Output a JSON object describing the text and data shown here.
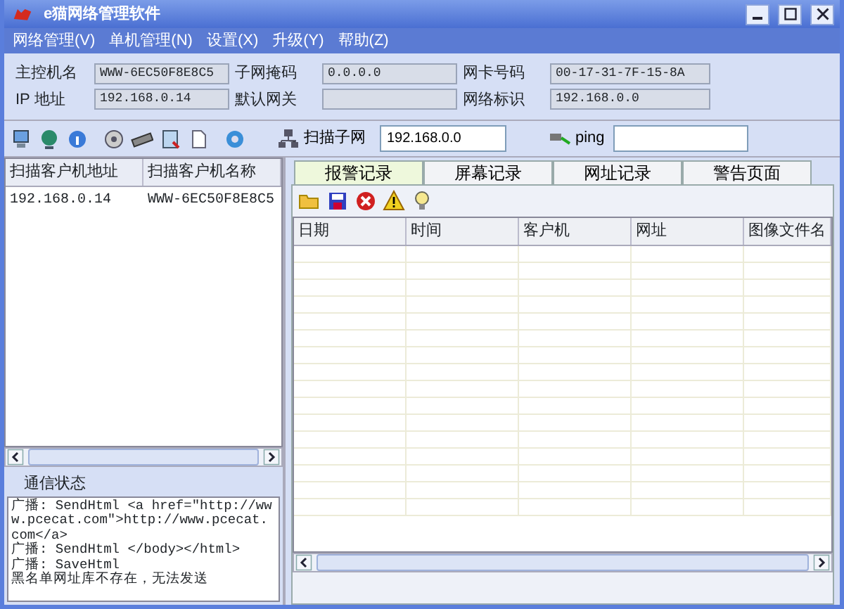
{
  "window": {
    "title": "e猫网络管理软件"
  },
  "menu": [
    "网络管理(V)",
    "单机管理(N)",
    "设置(X)",
    "升级(Y)",
    "帮助(Z)"
  ],
  "info": [
    {
      "label": "主控机名",
      "value": "WWW-6EC50F8E8C5"
    },
    {
      "label": "子网掩码",
      "value": "0.0.0.0"
    },
    {
      "label": "网卡号码",
      "value": "00-17-31-7F-15-8A"
    },
    {
      "label": "IP  地址",
      "value": "192.168.0.14"
    },
    {
      "label": "默认网关"
    },
    {
      "label": "网络标识",
      "value": "192.168.0.0"
    }
  ],
  "toolbar": {
    "scan_button": "扫描子网",
    "subnet_field": "192.168.0.0",
    "ping_button": "ping"
  },
  "scan_list": {
    "columns": [
      "扫描客户机地址",
      "扫描客户机名称"
    ],
    "rows": [
      [
        "192.168.0.14",
        "WWW-6EC50F8E8C5"
      ]
    ]
  },
  "status": {
    "title": "通信状态",
    "lines": [
      "广播: SendHtml <a href=\"http://www.pcecat.com\">http://www.pcecat.com</a>",
      "广播: SendHtml </body></html>",
      "广播: SaveHtml",
      "黑名单网址库不存在，无法发送"
    ]
  },
  "tabs": [
    {
      "label": "报警记录",
      "selected": true
    },
    {
      "label": "屏幕记录",
      "selected": false
    },
    {
      "label": "网址记录",
      "selected": false
    },
    {
      "label": "警告页面",
      "selected": false
    }
  ],
  "log_table": {
    "columns": [
      "日期",
      "时间",
      "客户机",
      "网址",
      "图像文件名"
    ]
  }
}
